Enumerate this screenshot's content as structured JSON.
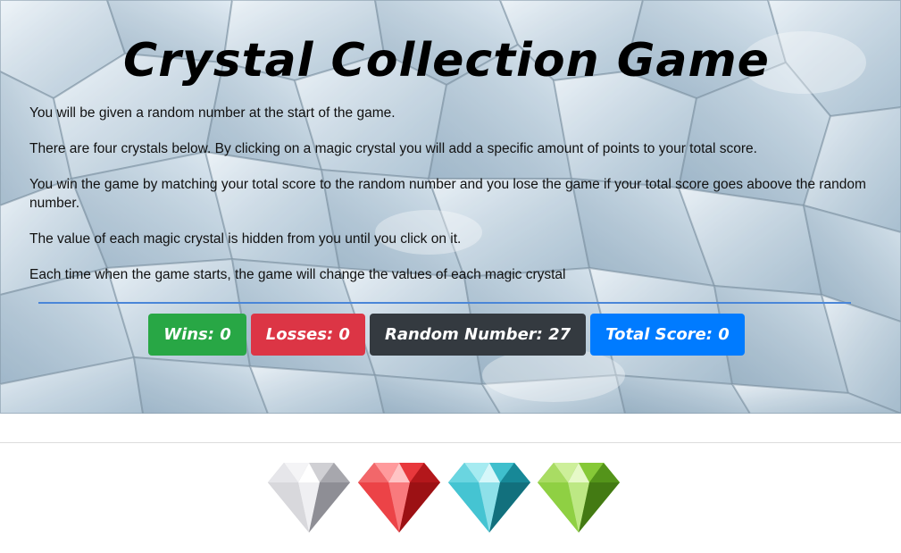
{
  "title": "Crystal Collection Game",
  "instructions": [
    "You will be given a random number at the start of the game.",
    "There are four crystals below. By clicking on a magic crystal you will add a specific amount of points to your total score.",
    "You win the game by matching your total score to the random number and you lose the game if your total score goes aboove the random number.",
    "The value of each magic crystal is hidden from you until you click on it.",
    "Each time when the game starts, the game will change the values of each magic crystal"
  ],
  "stats": {
    "wins": "Wins: 0",
    "losses": "Losses: 0",
    "random_number": "Random Number: 27",
    "total_score": "Total Score: 0"
  },
  "colors": {
    "wins": "#28a745",
    "losses": "#dc3545",
    "random_number": "#343a40",
    "total_score": "#007bff",
    "divider": "#4a86d8"
  },
  "crystals": [
    {
      "icon": "silver-crystal-icon",
      "color": "#c8c8cc"
    },
    {
      "icon": "red-crystal-icon",
      "color": "#e0262b"
    },
    {
      "icon": "cyan-crystal-icon",
      "color": "#2fb6c6"
    },
    {
      "icon": "green-crystal-icon",
      "color": "#7cc22e"
    }
  ]
}
